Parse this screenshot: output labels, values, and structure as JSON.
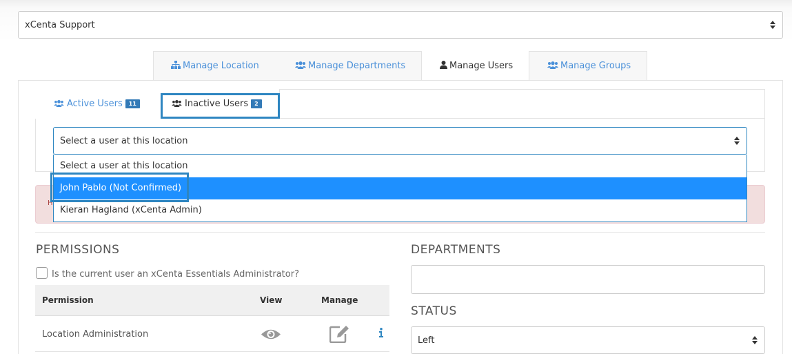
{
  "location_select": {
    "value": "xCenta Support"
  },
  "main_tabs": [
    {
      "label": "Manage Location",
      "icon": "sitemap-icon"
    },
    {
      "label": "Manage Departments",
      "icon": "users-icon"
    },
    {
      "label": "Manage Users",
      "icon": "user-icon"
    },
    {
      "label": "Manage Groups",
      "icon": "users-icon"
    }
  ],
  "user_tabs": [
    {
      "label": "Active Users",
      "count": "11",
      "icon": "users-icon"
    },
    {
      "label": "Inactive Users",
      "count": "2",
      "icon": "users-icon"
    }
  ],
  "user_select": {
    "value": "Select a user at this location",
    "options": [
      "Select a user at this location",
      "John Pablo (Not Confirmed)",
      "Kieran Hagland (xCenta Admin)"
    ],
    "highlighted_option": "John Pablo (Not Confirmed)"
  },
  "alert": {
    "visible_fragment": "H"
  },
  "permissions": {
    "title": "PERMISSIONS",
    "admin_checkbox_label": "Is the current user an xCenta Essentials Administrator?",
    "columns": [
      "Permission",
      "View",
      "Manage"
    ],
    "rows": [
      {
        "label": "Location Administration",
        "view_icon": "eye-icon",
        "manage_icon": "edit-icon",
        "info_icon": "info-icon"
      }
    ]
  },
  "departments": {
    "title": "DEPARTMENTS"
  },
  "status": {
    "title": "STATUS",
    "value": "Left"
  },
  "colors": {
    "link_blue": "#4a90d9",
    "highlight_border": "#2e86c1",
    "selected_option": "#1e90ff",
    "badge": "#337ab7",
    "alert_bg": "#f2dede"
  }
}
